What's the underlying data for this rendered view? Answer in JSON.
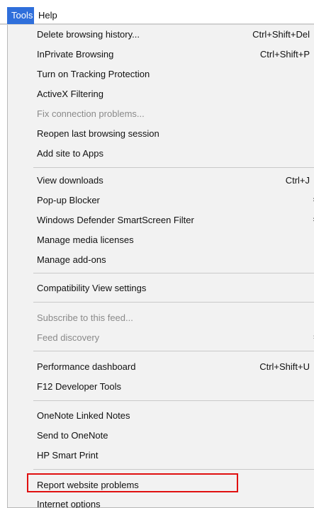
{
  "menubar": {
    "tools": "Tools",
    "help": "Help"
  },
  "menu": {
    "delete_history": {
      "label": "Delete browsing history...",
      "shortcut": "Ctrl+Shift+Del"
    },
    "inprivate": {
      "label": "InPrivate Browsing",
      "shortcut": "Ctrl+Shift+P"
    },
    "tracking": {
      "label": "Turn on Tracking Protection"
    },
    "activex": {
      "label": "ActiveX Filtering"
    },
    "fix_connection": {
      "label": "Fix connection problems..."
    },
    "reopen_session": {
      "label": "Reopen last browsing session"
    },
    "add_site": {
      "label": "Add site to Apps"
    },
    "view_downloads": {
      "label": "View downloads",
      "shortcut": "Ctrl+J"
    },
    "popup_blocker": {
      "label": "Pop-up Blocker",
      "submenu": "›"
    },
    "smartscreen": {
      "label": "Windows Defender SmartScreen Filter",
      "submenu": "›"
    },
    "media_licenses": {
      "label": "Manage media licenses"
    },
    "addons": {
      "label": "Manage add-ons"
    },
    "compat_view": {
      "label": "Compatibility View settings"
    },
    "subscribe_feed": {
      "label": "Subscribe to this feed..."
    },
    "feed_discovery": {
      "label": "Feed discovery",
      "submenu": "›"
    },
    "performance": {
      "label": "Performance dashboard",
      "shortcut": "Ctrl+Shift+U"
    },
    "f12_tools": {
      "label": "F12 Developer Tools"
    },
    "onenote_linked": {
      "label": "OneNote Linked Notes"
    },
    "send_onenote": {
      "label": "Send to OneNote"
    },
    "hp_smart_print": {
      "label": "HP Smart Print"
    },
    "report_problems": {
      "label": "Report website problems"
    },
    "internet_options": {
      "label": "Internet options"
    }
  },
  "colors": {
    "menubar_active": "#2f6fdb",
    "menu_background": "#f2f2f2",
    "disabled_text": "#8a8a8a",
    "annotation_highlight": "#e01010"
  }
}
